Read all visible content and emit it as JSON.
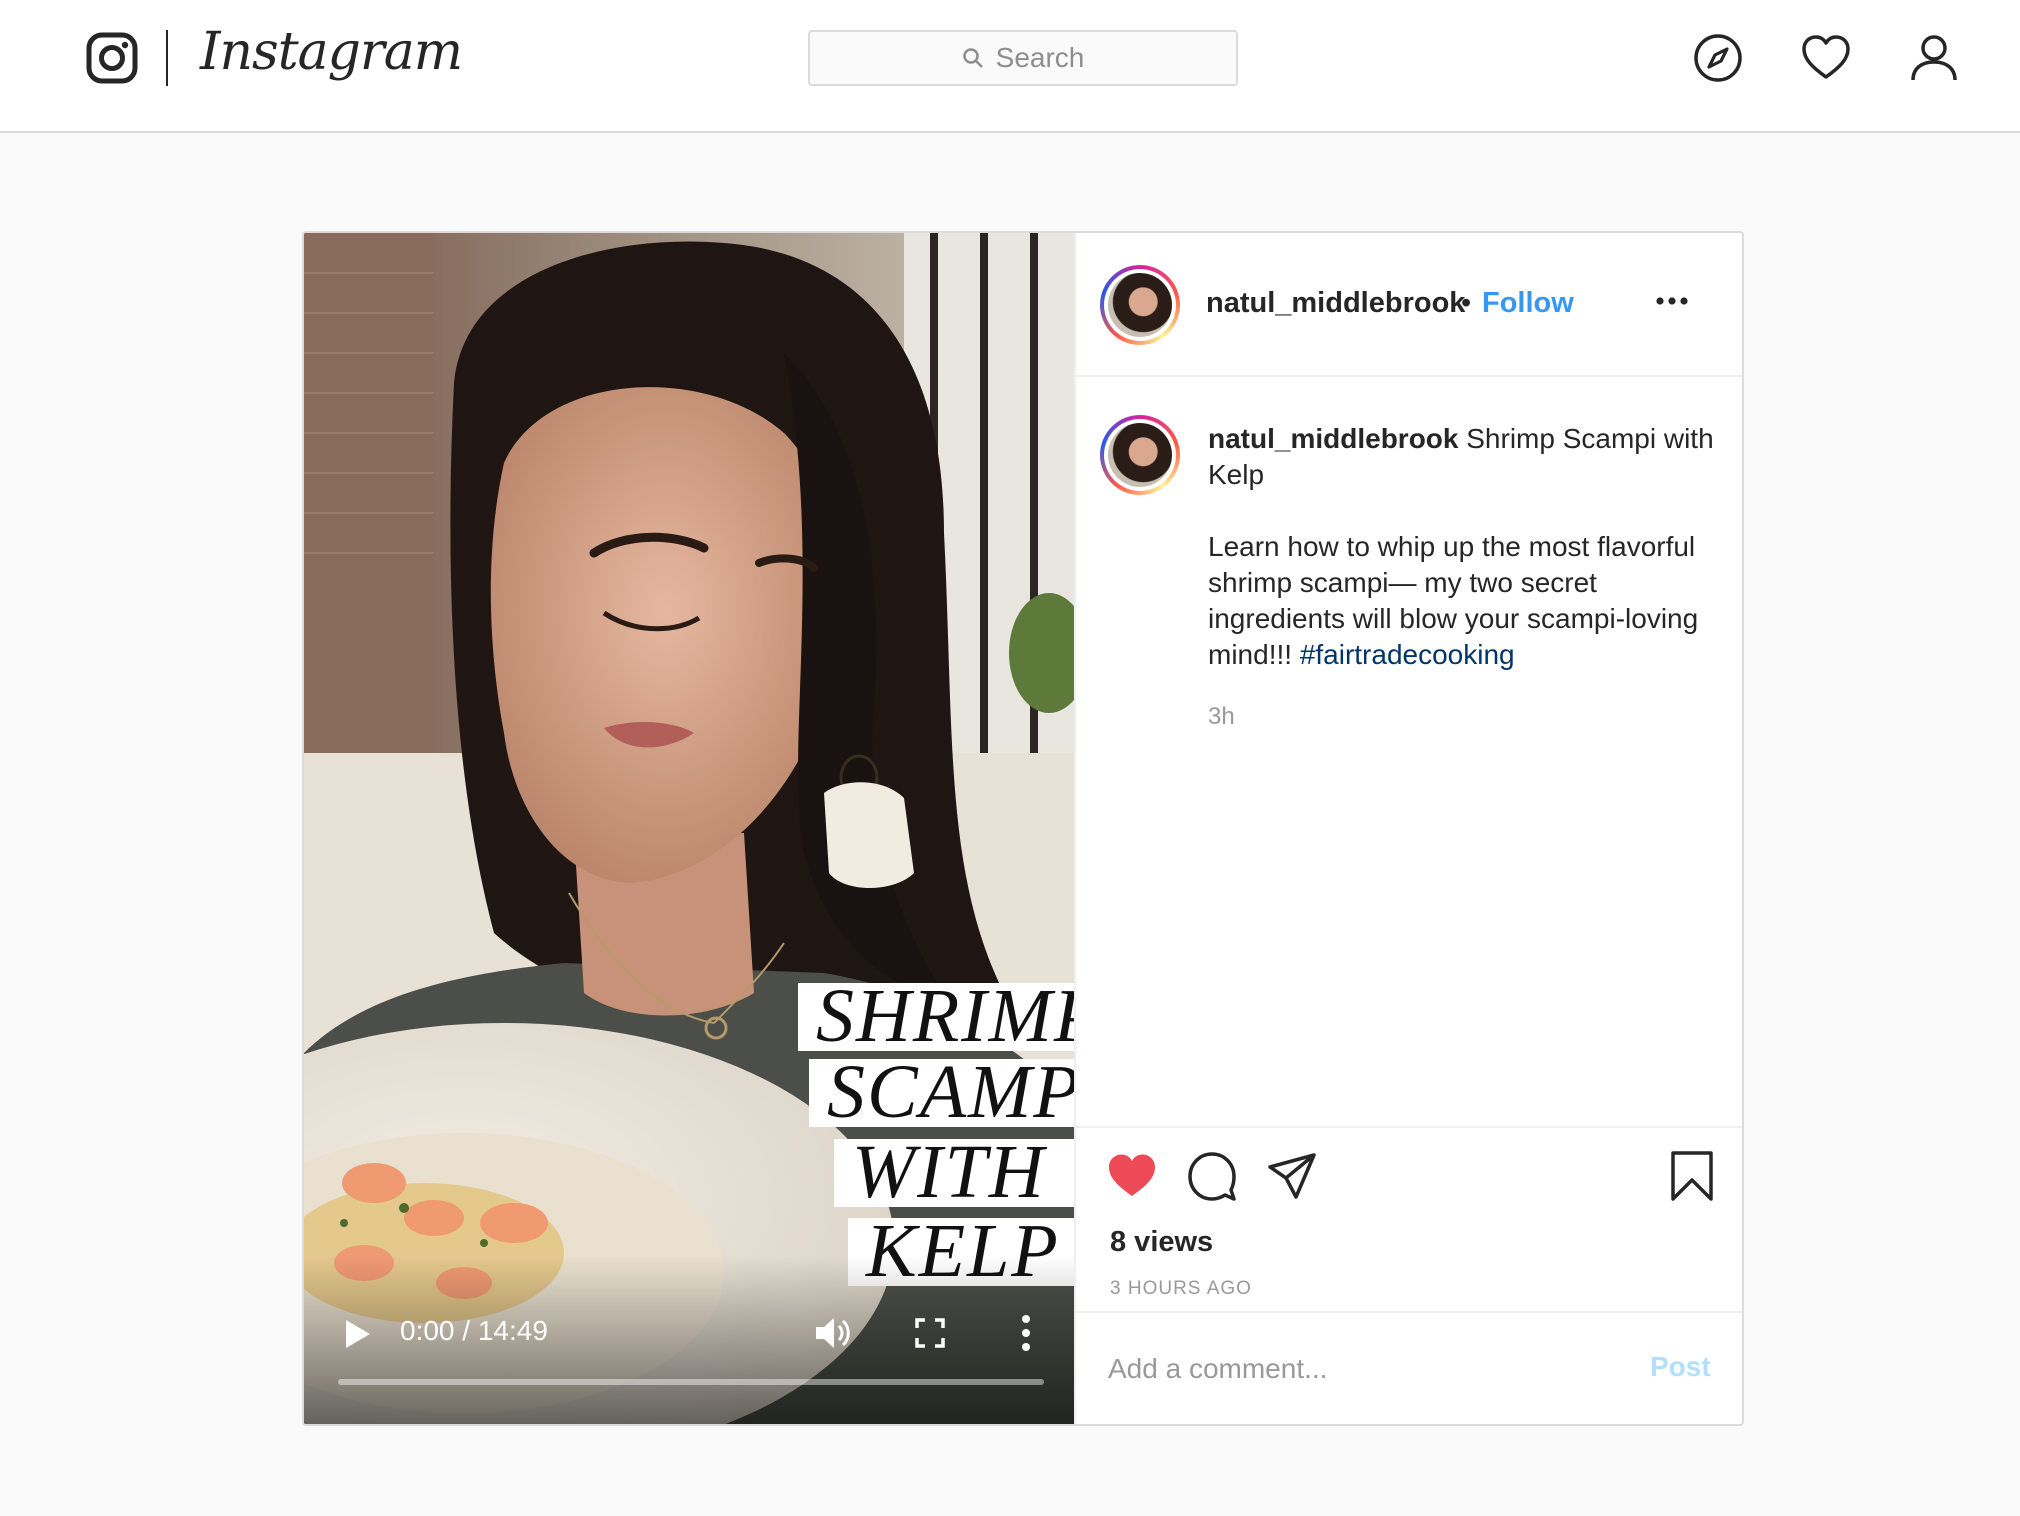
{
  "nav": {
    "wordmark": "Instagram",
    "search_placeholder": "Search",
    "icons": [
      "instagram-glyph-icon",
      "compass-icon",
      "heart-icon",
      "profile-icon"
    ]
  },
  "post": {
    "username": "natul_middlebrook",
    "separator": "•",
    "follow_label": "Follow",
    "caption_title": "Shrimp Scampi with Kelp",
    "caption_body": "Learn how to whip up the most flavorful shrimp scampi— my two secret ingredients will blow your scampi-loving mind!!!",
    "hashtag": "#fairtradecooking",
    "caption_age": "3h",
    "views": "8 views",
    "posted": "3 HOURS AGO",
    "comment_placeholder": "Add a comment...",
    "post_label": "Post",
    "liked": true,
    "like_color": "#ed4956"
  },
  "video": {
    "overlay_lines": [
      "SHRIMP",
      "SCAMPI",
      "WITH",
      "KELP"
    ],
    "time": "0:00 / 14:49",
    "progress": 0.0
  }
}
